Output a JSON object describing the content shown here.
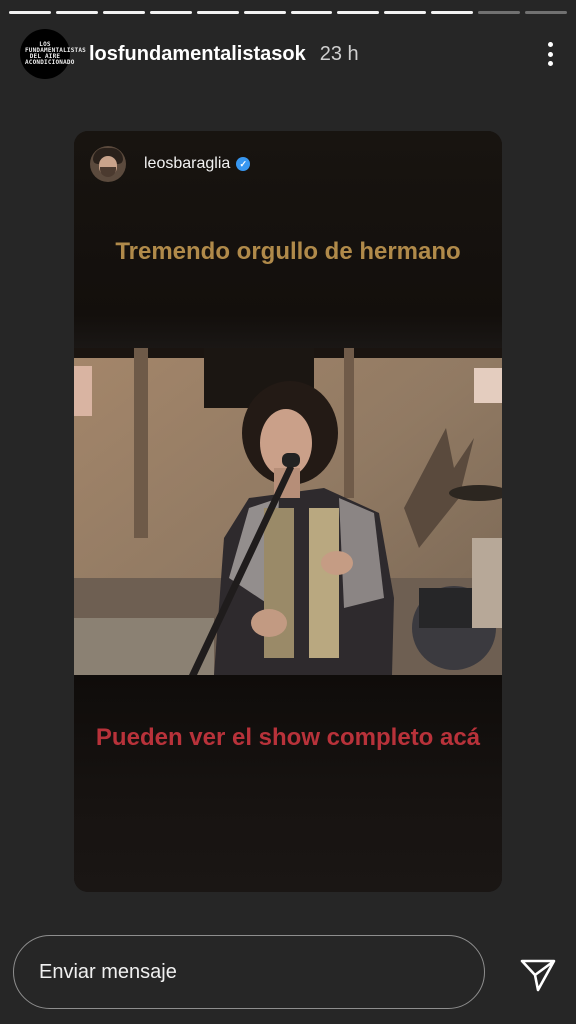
{
  "progress": {
    "total": 12,
    "completed": 10
  },
  "header": {
    "username": "losfundamentalistasok",
    "time": "23 h",
    "avatar_text": "LOS FUNDAMENTALISTAS DEL AIRE ACONDICIONADO"
  },
  "card": {
    "repost_username": "leosbaraglia",
    "caption_top": "Tremendo orgullo de hermano",
    "caption_bottom": "Pueden ver el show completo acá"
  },
  "reply": {
    "placeholder": "Enviar mensaje"
  },
  "icons": {
    "more": "more-vertical-icon",
    "send": "paper-plane-icon",
    "verified": "verified-badge-icon"
  },
  "colors": {
    "caption_top": "#b08a4a",
    "caption_bottom": "#b8323a",
    "verified": "#3897f0"
  }
}
